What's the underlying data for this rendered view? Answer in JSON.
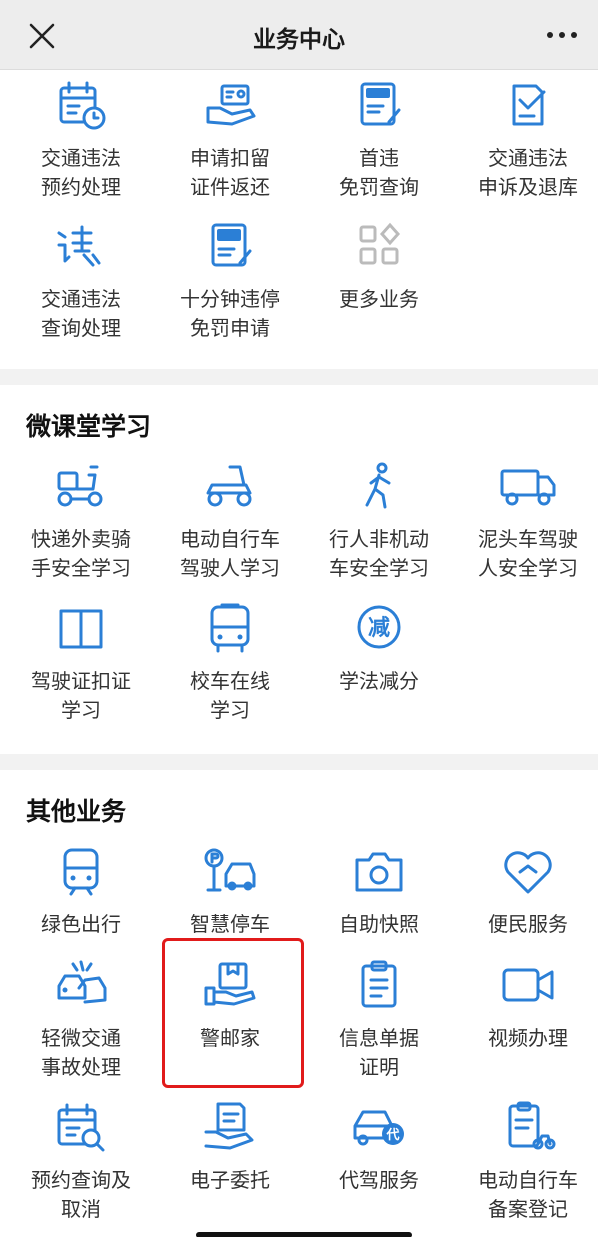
{
  "header": {
    "title": "业务中心",
    "close_icon": "close-icon",
    "more_icon": "more-dots-icon"
  },
  "colors": {
    "accent": "#2b7fd6",
    "highlight": "#e11b1b"
  },
  "top_grid": [
    {
      "line1": "交通违法",
      "line2": "预约处理",
      "icon": "calendar-clock-icon"
    },
    {
      "line1": "申请扣留",
      "line2": "证件返还",
      "icon": "hand-card-icon"
    },
    {
      "line1": "首违",
      "line2": "免罚查询",
      "icon": "exempt-doc-icon"
    },
    {
      "line1": "交通违法",
      "line2": "申诉及退库",
      "icon": "edit-doc-icon"
    },
    {
      "line1": "交通违法",
      "line2": "查询处理",
      "icon": "violation-icon"
    },
    {
      "line1": "十分钟违停",
      "line2": "免罚申请",
      "icon": "ten-minute-doc-icon"
    },
    {
      "line1": "更多业务",
      "line2": "",
      "icon": "more-grid-icon"
    }
  ],
  "study": {
    "title": "微课堂学习",
    "items": [
      {
        "line1": "快递外卖骑",
        "line2": "手安全学习",
        "icon": "delivery-scooter-icon"
      },
      {
        "line1": "电动自行车",
        "line2": "驾驶人学习",
        "icon": "ebike-icon"
      },
      {
        "line1": "行人非机动",
        "line2": "车安全学习",
        "icon": "pedestrian-icon"
      },
      {
        "line1": "泥头车驾驶",
        "line2": "人安全学习",
        "icon": "truck-icon"
      },
      {
        "line1": "驾驶证扣证",
        "line2": "学习",
        "icon": "book-icon"
      },
      {
        "line1": "校车在线",
        "line2": "学习",
        "icon": "school-bus-icon"
      },
      {
        "line1": "学法减分",
        "line2": "",
        "icon": "reduce-points-icon",
        "glyph": "减"
      }
    ]
  },
  "other": {
    "title": "其他业务",
    "items": [
      {
        "line1": "绿色出行",
        "line2": "",
        "icon": "train-icon"
      },
      {
        "line1": "智慧停车",
        "line2": "",
        "icon": "parking-icon"
      },
      {
        "line1": "自助快照",
        "line2": "",
        "icon": "camera-icon"
      },
      {
        "line1": "便民服务",
        "line2": "",
        "icon": "heart-icon"
      },
      {
        "line1": "轻微交通",
        "line2": "事故处理",
        "icon": "car-accident-icon"
      },
      {
        "line1": "警邮家",
        "line2": "",
        "icon": "hand-package-icon"
      },
      {
        "line1": "信息单据",
        "line2": "证明",
        "icon": "clipboard-icon"
      },
      {
        "line1": "视频办理",
        "line2": "",
        "icon": "video-icon"
      },
      {
        "line1": "预约查询及",
        "line2": "取消",
        "icon": "calendar-search-icon"
      },
      {
        "line1": "电子委托",
        "line2": "",
        "icon": "hand-doc-icon"
      },
      {
        "line1": "代驾服务",
        "line2": "",
        "icon": "designated-driver-icon",
        "glyph": "代"
      },
      {
        "line1": "电动自行车",
        "line2": "备案登记",
        "icon": "ebike-register-icon"
      }
    ]
  }
}
